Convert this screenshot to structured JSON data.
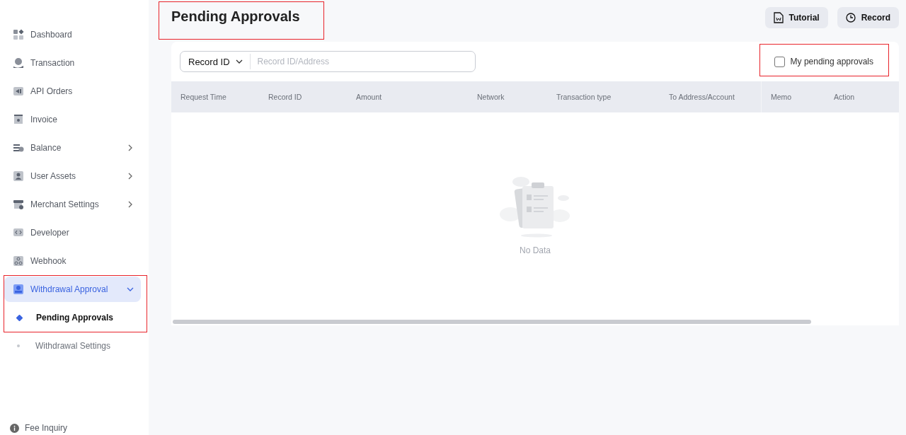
{
  "sidebar": {
    "items": [
      {
        "label": "Dashboard",
        "selected": false
      },
      {
        "label": "Transaction",
        "selected": false
      },
      {
        "label": "API Orders",
        "selected": false
      },
      {
        "label": "Invoice",
        "selected": false
      },
      {
        "label": "Balance",
        "selected": false,
        "expanded": false
      },
      {
        "label": "User Assets",
        "selected": false,
        "expanded": false
      },
      {
        "label": "Merchant Settings",
        "selected": false,
        "expanded": false
      },
      {
        "label": "Developer",
        "selected": false
      },
      {
        "label": "Webhook",
        "selected": false
      },
      {
        "label": "Withdrawal Approval",
        "selected": true,
        "expanded": true,
        "highlighted": true,
        "children": [
          {
            "label": "Pending Approvals",
            "selected": true
          },
          {
            "label": "Withdrawal Settings",
            "selected": false
          }
        ]
      }
    ],
    "footer_link": "Fee Inquiry"
  },
  "page": {
    "title": "Pending Approvals",
    "title_highlighted": true,
    "buttons": [
      "Tutorial",
      "Record"
    ]
  },
  "filter": {
    "select_value": "Record ID",
    "search_placeholder": "Record ID/Address",
    "checkbox": {
      "label": "My pending approvals",
      "checked": false,
      "highlighted": true
    }
  },
  "table": {
    "columns": [
      "Request Time",
      "Record ID",
      "Amount",
      "Network",
      "Transaction type",
      "To Address/Account",
      "Memo",
      "Action"
    ],
    "empty_text": "No Data"
  }
}
